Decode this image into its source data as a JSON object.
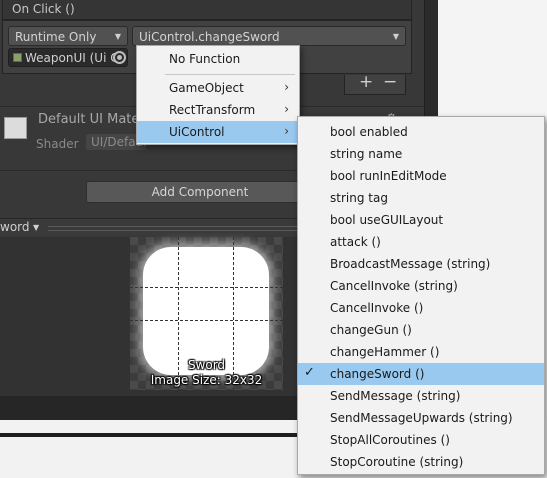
{
  "event": {
    "title": "On Click ()",
    "runtime_option": "Runtime Only",
    "function_value": "UiControl.changeSword",
    "object_value": "WeaponUI (Ui C",
    "add_label": "+",
    "remove_label": "−"
  },
  "material": {
    "name": "Default UI Mate",
    "shader_label": "Shader",
    "shader_value": "UI/Default"
  },
  "add_component_label": "Add Component",
  "preview": {
    "title": "word",
    "sprite_name": "Sword",
    "image_size": "Image Size: 32x32"
  },
  "menu1": {
    "items": [
      {
        "label": "No Function",
        "has_submenu": false
      },
      {
        "label": "GameObject",
        "has_submenu": true
      },
      {
        "label": "RectTransform",
        "has_submenu": true
      },
      {
        "label": "UiControl",
        "has_submenu": true,
        "selected": true
      }
    ]
  },
  "menu2": {
    "items": [
      {
        "label": "bool enabled"
      },
      {
        "label": "string name"
      },
      {
        "label": "bool runInEditMode"
      },
      {
        "label": "string tag"
      },
      {
        "label": "bool useGUILayout"
      },
      {
        "label": "attack ()"
      },
      {
        "label": "BroadcastMessage (string)"
      },
      {
        "label": "CancelInvoke (string)"
      },
      {
        "label": "CancelInvoke ()"
      },
      {
        "label": "changeGun ()"
      },
      {
        "label": "changeHammer ()"
      },
      {
        "label": "changeSword ()",
        "checked": true,
        "selected": true
      },
      {
        "label": "SendMessage (string)"
      },
      {
        "label": "SendMessageUpwards (string)"
      },
      {
        "label": "StopAllCoroutines ()"
      },
      {
        "label": "StopCoroutine (string)"
      }
    ],
    "check_glyph": "✓",
    "arrow_glyph": "›"
  },
  "colors": {
    "menu_highlight": "#99c9ef",
    "inspector_bg": "#383838"
  }
}
